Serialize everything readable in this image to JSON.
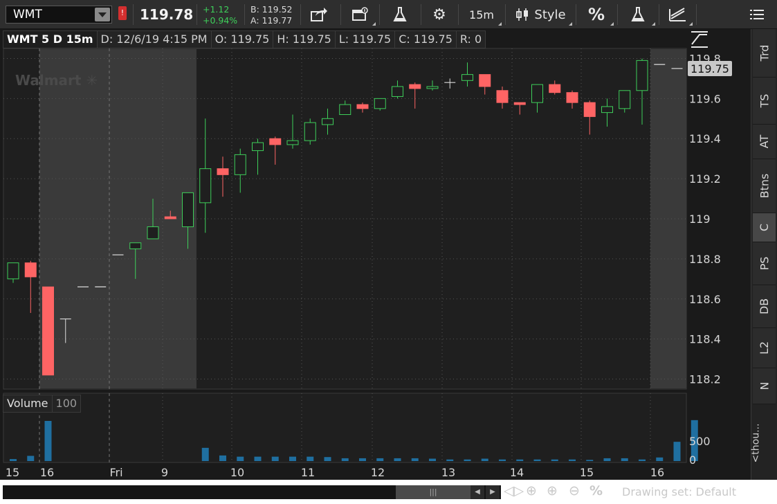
{
  "toolbar": {
    "symbol": "WMT",
    "alert_label": "!",
    "last": "119.78",
    "change": "+1.12",
    "change_pct": "+0.94%",
    "bid": "B: 119.52",
    "ask": "A: 119.77",
    "share_icon": "share-icon",
    "active_trader_icon": "active-trader-icon",
    "studies_icon": "beaker-icon",
    "settings_icon": "gear-icon",
    "timeframe": "15m",
    "style_label": "Style",
    "percent_label": "%",
    "studies2_icon": "beaker-icon",
    "drawings_icon": "drawings-icon",
    "menu_icon": "menu-icon",
    "up_color": "#3ecf5a",
    "down_color": "#ff6464"
  },
  "header": {
    "symbol_period": "WMT 5 D 15m",
    "date": "D: 12/6/19 4:15 PM",
    "open": "O: 119.75",
    "high": "H: 119.75",
    "low": "L: 119.75",
    "close": "C: 119.75",
    "range": "R: 0"
  },
  "watermark": "Walmart",
  "price_marker": "119.75",
  "volume_header": {
    "label": "Volume",
    "value": "100"
  },
  "volume_axis": [
    "500",
    "0"
  ],
  "volume_axis_unit": "<thou...",
  "side_tabs": [
    {
      "label": "Trd",
      "active": false
    },
    {
      "label": "TS",
      "active": false
    },
    {
      "label": "AT",
      "active": false
    },
    {
      "label": "Btns",
      "active": false
    },
    {
      "label": "C",
      "active": true
    },
    {
      "label": "PS",
      "active": false
    },
    {
      "label": "DB",
      "active": false
    },
    {
      "label": "L2",
      "active": false
    },
    {
      "label": "N",
      "active": false
    }
  ],
  "bottom": {
    "drawing_set": "Drawing set: Default",
    "zoom_percent": "%"
  },
  "chart_data": {
    "type": "candlestick",
    "title": "WMT 5 D 15m",
    "ylim": [
      118.15,
      119.85
    ],
    "y_ticks": [
      "119.8",
      "119.6",
      "119.4",
      "119.2",
      "119",
      "118.8",
      "118.6",
      "118.4",
      "118.2"
    ],
    "x_ticks": [
      "15",
      "16",
      "Fri",
      "9",
      "10",
      "11",
      "12",
      "13",
      "14",
      "15",
      "16"
    ],
    "grid": true,
    "shaded_sessions": [
      "extended hours before 9:30",
      "after-hours after 16:00"
    ],
    "candles": [
      {
        "o": 118.7,
        "h": 118.78,
        "l": 118.68,
        "c": 118.78
      },
      {
        "o": 118.78,
        "h": 118.79,
        "l": 118.53,
        "c": 118.71
      },
      {
        "o": 118.66,
        "h": 118.66,
        "l": 118.22,
        "c": 118.22
      },
      {
        "o": 118.5,
        "h": 118.5,
        "l": 118.38,
        "c": 118.5
      },
      {
        "o": 118.66,
        "h": 118.66,
        "l": 118.66,
        "c": 118.66
      },
      {
        "o": 118.66,
        "h": 118.66,
        "l": 118.66,
        "c": 118.66
      },
      {
        "o": 118.82,
        "h": 118.82,
        "l": 118.82,
        "c": 118.82
      },
      {
        "o": 118.85,
        "h": 118.88,
        "l": 118.7,
        "c": 118.88
      },
      {
        "o": 118.9,
        "h": 119.1,
        "l": 118.9,
        "c": 118.96
      },
      {
        "o": 119.01,
        "h": 119.04,
        "l": 119.0,
        "c": 119.0
      },
      {
        "o": 118.96,
        "h": 119.13,
        "l": 118.85,
        "c": 119.13
      },
      {
        "o": 119.08,
        "h": 119.5,
        "l": 118.93,
        "c": 119.25
      },
      {
        "o": 119.25,
        "h": 119.31,
        "l": 119.11,
        "c": 119.22
      },
      {
        "o": 119.22,
        "h": 119.35,
        "l": 119.13,
        "c": 119.32
      },
      {
        "o": 119.34,
        "h": 119.4,
        "l": 119.22,
        "c": 119.38
      },
      {
        "o": 119.4,
        "h": 119.41,
        "l": 119.27,
        "c": 119.37
      },
      {
        "o": 119.37,
        "h": 119.52,
        "l": 119.35,
        "c": 119.39
      },
      {
        "o": 119.39,
        "h": 119.5,
        "l": 119.37,
        "c": 119.48
      },
      {
        "o": 119.47,
        "h": 119.55,
        "l": 119.42,
        "c": 119.5
      },
      {
        "o": 119.52,
        "h": 119.59,
        "l": 119.52,
        "c": 119.57
      },
      {
        "o": 119.57,
        "h": 119.58,
        "l": 119.53,
        "c": 119.55
      },
      {
        "o": 119.55,
        "h": 119.6,
        "l": 119.54,
        "c": 119.6
      },
      {
        "o": 119.61,
        "h": 119.69,
        "l": 119.6,
        "c": 119.66
      },
      {
        "o": 119.67,
        "h": 119.68,
        "l": 119.55,
        "c": 119.65
      },
      {
        "o": 119.65,
        "h": 119.69,
        "l": 119.64,
        "c": 119.66
      },
      {
        "o": 119.68,
        "h": 119.7,
        "l": 119.65,
        "c": 119.68
      },
      {
        "o": 119.69,
        "h": 119.78,
        "l": 119.66,
        "c": 119.72
      },
      {
        "o": 119.72,
        "h": 119.72,
        "l": 119.62,
        "c": 119.66
      },
      {
        "o": 119.64,
        "h": 119.66,
        "l": 119.55,
        "c": 119.58
      },
      {
        "o": 119.58,
        "h": 119.58,
        "l": 119.52,
        "c": 119.57
      },
      {
        "o": 119.58,
        "h": 119.67,
        "l": 119.53,
        "c": 119.67
      },
      {
        "o": 119.67,
        "h": 119.69,
        "l": 119.62,
        "c": 119.63
      },
      {
        "o": 119.63,
        "h": 119.64,
        "l": 119.55,
        "c": 119.58
      },
      {
        "o": 119.58,
        "h": 119.59,
        "l": 119.42,
        "c": 119.51
      },
      {
        "o": 119.53,
        "h": 119.6,
        "l": 119.46,
        "c": 119.56
      },
      {
        "o": 119.55,
        "h": 119.64,
        "l": 119.53,
        "c": 119.64
      },
      {
        "o": 119.64,
        "h": 119.8,
        "l": 119.47,
        "c": 119.79
      },
      {
        "o": 119.77,
        "h": 119.77,
        "l": 119.77,
        "c": 119.77
      },
      {
        "o": 119.75,
        "h": 119.75,
        "l": 119.75,
        "c": 119.75
      }
    ],
    "volume": [
      50,
      130,
      1000,
      0,
      0,
      0,
      0,
      0,
      0,
      0,
      0,
      330,
      140,
      110,
      110,
      110,
      110,
      110,
      100,
      70,
      70,
      70,
      70,
      70,
      60,
      40,
      40,
      60,
      40,
      40,
      40,
      40,
      40,
      30,
      70,
      70,
      40,
      90,
      480,
      1020,
      0
    ]
  }
}
